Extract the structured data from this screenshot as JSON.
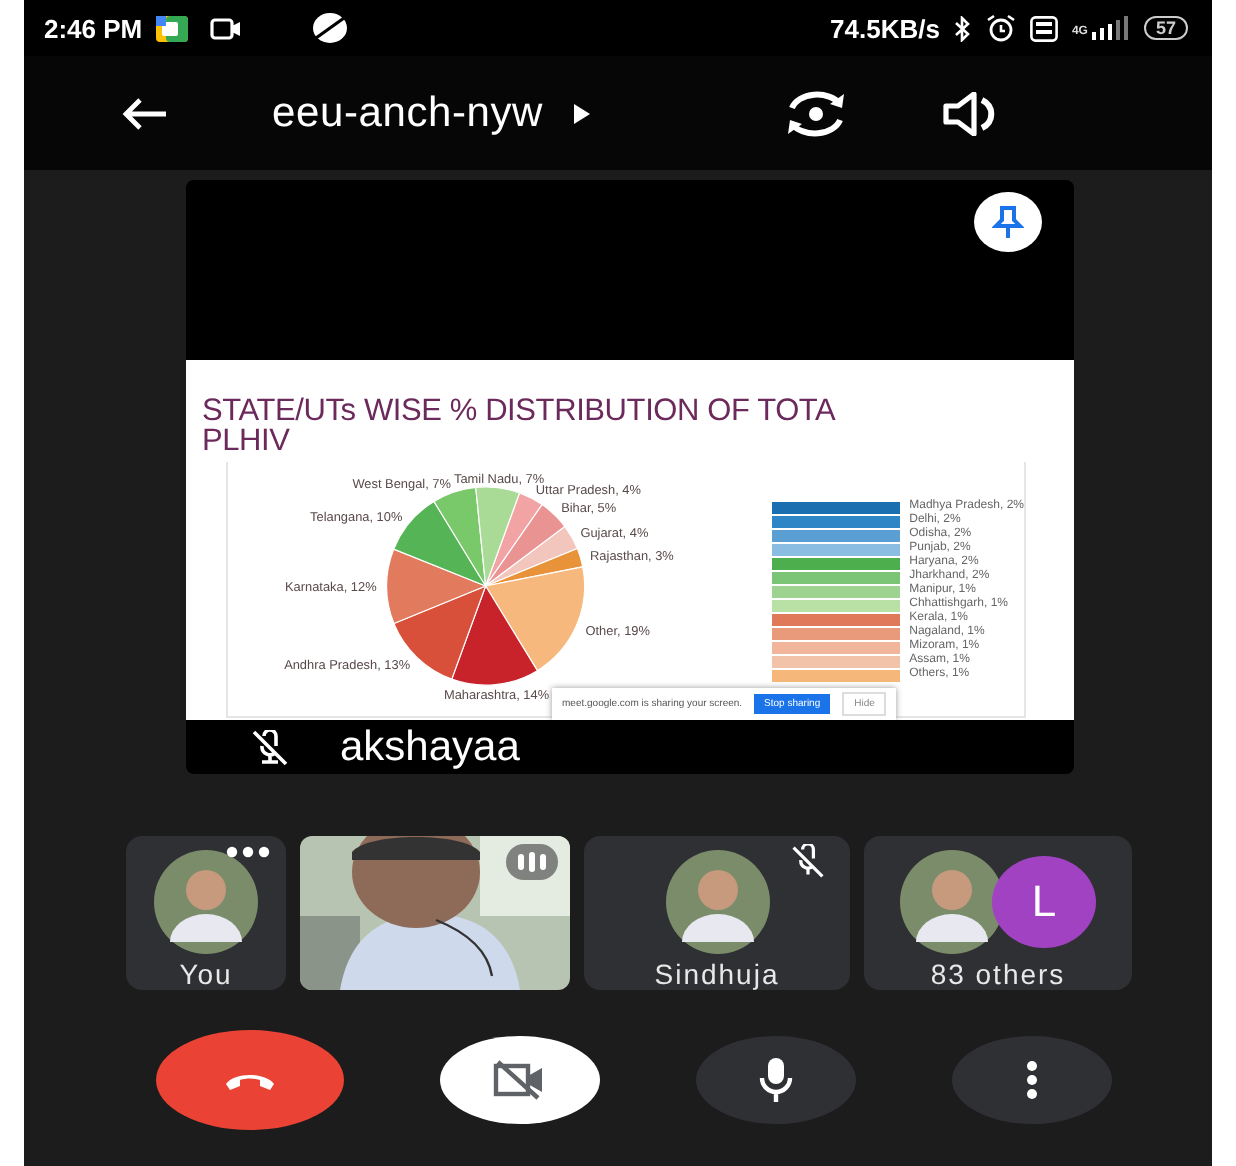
{
  "status_bar": {
    "time": "2:46 PM",
    "network_speed": "74.5KB/s",
    "network_type": "4G",
    "battery": "57"
  },
  "header": {
    "meeting_code": "eeu-anch-nyw"
  },
  "stage": {
    "presenter": "akshayaa",
    "muted": true,
    "pinned": true,
    "slide": {
      "title_lines": [
        "STATE/UTs WISE % DISTRIBUTION OF TOTA",
        "PLHIV"
      ],
      "chart_data": {
        "type": "pie",
        "values": [
          4,
          5,
          4,
          3,
          19,
          14,
          13,
          12,
          10,
          7,
          7
        ],
        "colors": [
          "#f2a3a3",
          "#e99393",
          "#f3c6bd",
          "#e8923a",
          "#f6b87c",
          "#c8232b",
          "#d9503a",
          "#e27a5e",
          "#55b455",
          "#79c96a",
          "#a9db97"
        ],
        "value_labels": [
          "Uttar Pradesh, 4%",
          "Bihar, 5%",
          "Gujarat, 4%",
          "Rajasthan, 3%",
          "Other, 19%",
          "Maharashtra, 14%",
          "Andhra Pradesh, 13%",
          "Karnataka, 12%",
          "Telangana, 10%",
          "West Bengal, 7%",
          "Tamil Nadu, 7%"
        ]
      },
      "breakdown": [
        {
          "label": "Madhya Pradesh, 2%",
          "color": "#1a6fb0"
        },
        {
          "label": "Delhi, 2%",
          "color": "#2f86c6"
        },
        {
          "label": "Odisha, 2%",
          "color": "#5a9fd4"
        },
        {
          "label": "Punjab, 2%",
          "color": "#8bbde3"
        },
        {
          "label": "Haryana, 2%",
          "color": "#4cae4c"
        },
        {
          "label": "Jharkhand, 2%",
          "color": "#7cc576"
        },
        {
          "label": "Manipur, 1%",
          "color": "#9ed28f"
        },
        {
          "label": "Chhattishgarh, 1%",
          "color": "#b9e0a5"
        },
        {
          "label": "Kerala, 1%",
          "color": "#e0795a"
        },
        {
          "label": "Nagaland, 1%",
          "color": "#e89a7a"
        },
        {
          "label": "Mizoram, 1%",
          "color": "#f0b59a"
        },
        {
          "label": "Assam, 1%",
          "color": "#f2c3a8"
        },
        {
          "label": "Others, 1%",
          "color": "#f5b87a"
        }
      ],
      "share_banner": {
        "message": "meet.google.com is sharing your screen.",
        "stop_button": "Stop sharing",
        "hide_button": "Hide"
      }
    }
  },
  "participants": [
    {
      "kind": "avatar",
      "name": "You",
      "menu": true,
      "muted": false
    },
    {
      "kind": "video",
      "speaking": true
    },
    {
      "kind": "avatar",
      "name": "Sindhuja",
      "menu": false,
      "muted": true
    },
    {
      "kind": "group",
      "name": "83 others",
      "badge": "L",
      "color": "#a142c3"
    }
  ],
  "controls": [
    {
      "kind": "end_call"
    },
    {
      "kind": "camera",
      "on": false
    },
    {
      "kind": "mic",
      "on": true
    },
    {
      "kind": "more"
    }
  ]
}
